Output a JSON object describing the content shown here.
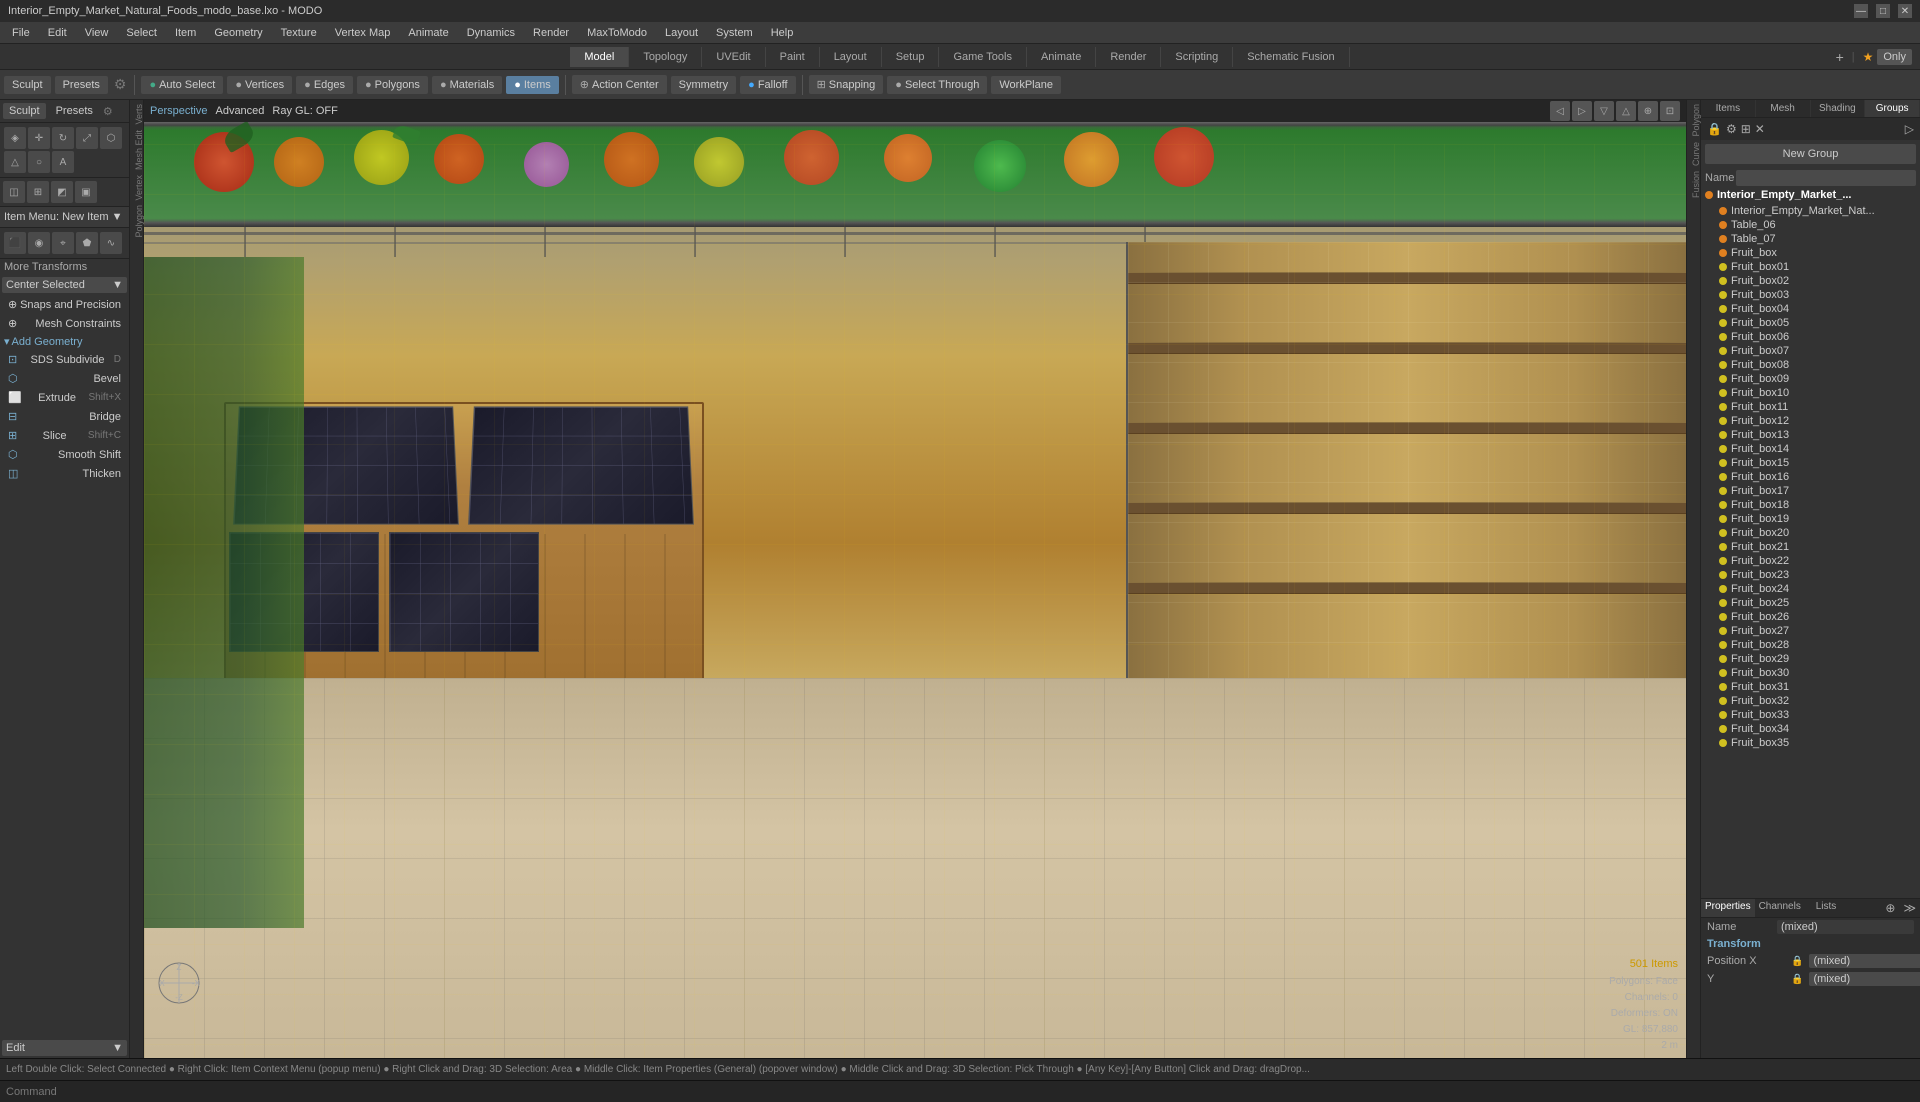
{
  "titlebar": {
    "title": "Interior_Empty_Market_Natural_Foods_modo_base.lxo - MODO",
    "controls": [
      "—",
      "□",
      "✕"
    ]
  },
  "menubar": {
    "items": [
      "File",
      "Edit",
      "View",
      "Select",
      "Item",
      "Geometry",
      "Texture",
      "Vertex Map",
      "Animate",
      "Dynamics",
      "Render",
      "MaxToModo",
      "Layout",
      "System",
      "Help"
    ]
  },
  "modetabs": {
    "tabs": [
      "Model",
      "Topology",
      "UVEdit",
      "Paint",
      "Layout",
      "Setup",
      "Game Tools",
      "Animate",
      "Render",
      "Scripting",
      "Schematic Fusion"
    ],
    "active": "Model",
    "right_label": "Only",
    "plus_label": "+"
  },
  "toolbar": {
    "sculpt_label": "Sculpt",
    "presets_label": "Presets",
    "buttons": [
      {
        "label": "Auto Select",
        "icon": "●"
      },
      {
        "label": "Vertices",
        "icon": "●"
      },
      {
        "label": "Edges",
        "icon": "●"
      },
      {
        "label": "Polygons",
        "icon": "●"
      },
      {
        "label": "Materials",
        "icon": "●"
      },
      {
        "label": "Items",
        "icon": "●",
        "active": true
      },
      {
        "label": "Action Center",
        "icon": "●"
      },
      {
        "label": "Symmetry",
        "icon": "●"
      },
      {
        "label": "Falloff",
        "icon": "●"
      },
      {
        "label": "Snapping",
        "icon": "●"
      },
      {
        "label": "Select Through",
        "icon": "●"
      },
      {
        "label": "WorkPlane",
        "icon": "●"
      }
    ]
  },
  "left_panel": {
    "item_menu_label": "Item Menu: New Item",
    "more_transforms": "More Transforms",
    "center_selected": "Center Selected",
    "snaps_label": "Snaps and Precision",
    "mesh_constraints": "Mesh Constraints",
    "add_geometry": "Add Geometry",
    "tools": [
      {
        "label": "SDS Subdivide",
        "shortcut": "D"
      },
      {
        "label": "Bevel",
        "shortcut": ""
      },
      {
        "label": "Extrude",
        "shortcut": "Shift+X"
      },
      {
        "label": "Bridge",
        "shortcut": ""
      },
      {
        "label": "Slice",
        "shortcut": "Shift+C"
      },
      {
        "label": "Smooth Shift",
        "shortcut": ""
      },
      {
        "label": "Thicken",
        "shortcut": ""
      }
    ],
    "edit_label": "Edit"
  },
  "viewport": {
    "label": "Perspective",
    "sub_label": "Advanced",
    "ray_gl": "Ray GL: OFF",
    "info": {
      "items": "501 Items",
      "polygons": "Polygons: Face",
      "channels": "Channels: 0",
      "deformers": "Deformers: ON",
      "gl": "GL: 857,880",
      "scale": "2 m"
    }
  },
  "right_panel": {
    "tabs": [
      "Items",
      "Mesh",
      "Shading",
      "Groups"
    ],
    "active_tab": "Groups",
    "subtabs": [
      "Name",
      "Groups"
    ],
    "new_group_label": "New Group",
    "name_label": "Name",
    "scene_name": "Interior_Empty_Market_...",
    "items": [
      "Interior_Empty_Market_Nat...",
      "Table_06",
      "Table_07",
      "Fruit_box",
      "Fruit_box01",
      "Fruit_box02",
      "Fruit_box03",
      "Fruit_box04",
      "Fruit_box05",
      "Fruit_box06",
      "Fruit_box07",
      "Fruit_box08",
      "Fruit_box09",
      "Fruit_box10",
      "Fruit_box11",
      "Fruit_box12",
      "Fruit_box13",
      "Fruit_box14",
      "Fruit_box15",
      "Fruit_box16",
      "Fruit_box17",
      "Fruit_box18",
      "Fruit_box19",
      "Fruit_box20",
      "Fruit_box21",
      "Fruit_box22",
      "Fruit_box23",
      "Fruit_box24",
      "Fruit_box25",
      "Fruit_box26",
      "Fruit_box27",
      "Fruit_box28",
      "Fruit_box29",
      "Fruit_box30",
      "Fruit_box31",
      "Fruit_box32",
      "Fruit_box33",
      "Fruit_box34",
      "Fruit_box35"
    ]
  },
  "properties": {
    "tabs": [
      "Properties",
      "Channels",
      "Lists"
    ],
    "active_tab": "Properties",
    "name_label": "Name",
    "name_value": "(mixed)",
    "transform_label": "Transform",
    "position_x_label": "Position X",
    "position_x_value": "(mixed)",
    "position_y_label": "Y",
    "position_y_value": "(mixed)"
  },
  "statusbar": {
    "text": "Left Double Click: Select Connected ● Right Click: Item Context Menu (popup menu) ● Right Click and Drag: 3D Selection: Area ● Middle Click: Item Properties (General) (popover window) ● Middle Click and Drag: 3D Selection: Pick Through ● [Any Key]-[Any Button] Click and Drag: dragDrop..."
  },
  "commandbar": {
    "label": "Command",
    "placeholder": ""
  },
  "sidebar_strips": {
    "left": [
      "Verts",
      "Edit"
    ],
    "right": [
      "Polygon",
      "Curve",
      "Fusion"
    ]
  },
  "colors": {
    "accent": "#5a7fa0",
    "active_tab": "#4a4a4a",
    "dot_orange": "#e08020",
    "dot_yellow": "#d0c020",
    "dot_green": "#20a040",
    "banner_green": "#3a7a3a"
  }
}
